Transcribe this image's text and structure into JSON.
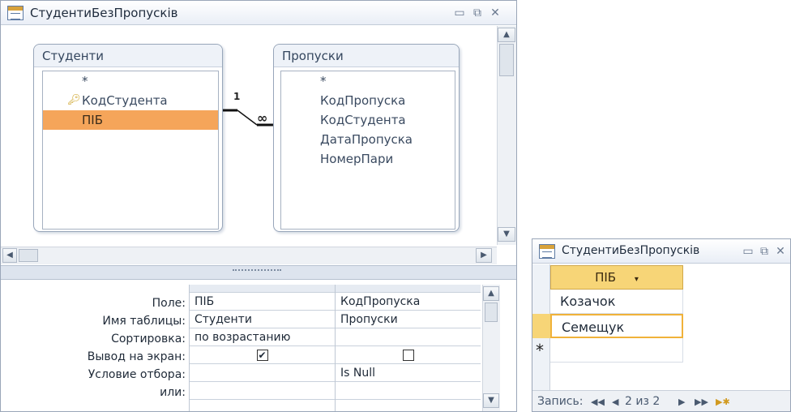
{
  "query_window": {
    "title": "СтудентиБезПропусків",
    "controls": [
      "▭",
      "⧉",
      "✕"
    ]
  },
  "tables": {
    "students": {
      "name": "Студенти",
      "fields": [
        "*",
        "КодСтудента",
        "ПІБ"
      ],
      "key_field_index": 1,
      "selected_field_index": 2
    },
    "absences": {
      "name": "Пропуски",
      "fields": [
        "*",
        "КодПропуска",
        "КодСтудента",
        "ДатаПропуска",
        "НомерПари"
      ]
    }
  },
  "relationship": {
    "one_label": "1",
    "many_label": "∞"
  },
  "grid": {
    "row_labels": [
      "Поле:",
      "Имя таблицы:",
      "Сортировка:",
      "Вывод на экран:",
      "Условие отбора:",
      "или:"
    ],
    "columns": [
      {
        "field": "ПІБ",
        "table": "Студенти",
        "sort": "по возрастанию",
        "show": "✔",
        "criteria": "",
        "or": ""
      },
      {
        "field": "КодПропуска",
        "table": "Пропуски",
        "sort": "",
        "show": "",
        "criteria": "Is Null",
        "or": ""
      }
    ]
  },
  "datasheet_window": {
    "title": "СтудентиБезПропусків",
    "column_header": "ПІБ",
    "rows": [
      "Козачок",
      "Семещук"
    ],
    "new_row_marker": "*",
    "record_label": "Запись:",
    "record_position": "2 из 2",
    "nav_first": "◀◀",
    "nav_prev": "◀",
    "nav_next": "▶",
    "nav_last": "▶▶"
  }
}
